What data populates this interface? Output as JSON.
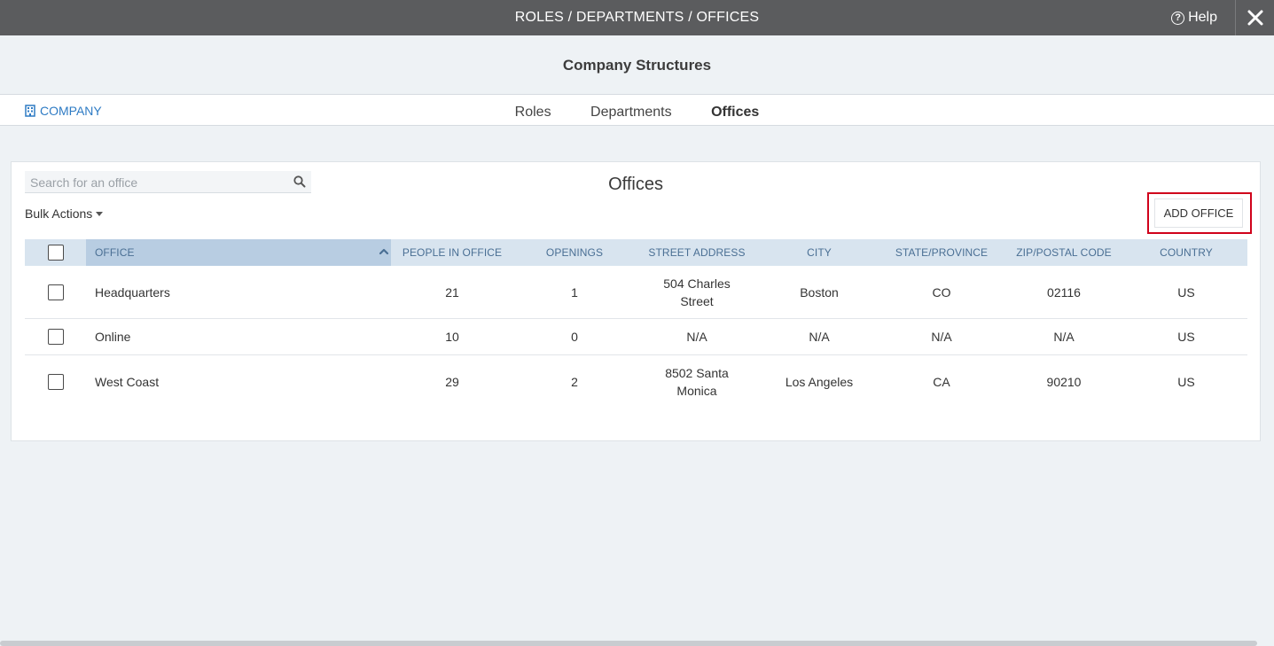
{
  "topbar": {
    "title": "ROLES / DEPARTMENTS / OFFICES",
    "help_label": "Help"
  },
  "header": {
    "title": "Company Structures"
  },
  "nav": {
    "company_label": "COMPANY",
    "tabs": [
      {
        "label": "Roles",
        "active": false
      },
      {
        "label": "Departments",
        "active": false
      },
      {
        "label": "Offices",
        "active": true
      }
    ]
  },
  "panel": {
    "title": "Offices",
    "search_placeholder": "Search for an office",
    "bulk_actions_label": "Bulk Actions",
    "add_button_label": "ADD OFFICE"
  },
  "table": {
    "columns": {
      "office": "OFFICE",
      "people": "PEOPLE IN OFFICE",
      "openings": "OPENINGS",
      "street": "STREET ADDRESS",
      "city": "CITY",
      "state": "STATE/PROVINCE",
      "zip": "ZIP/POSTAL CODE",
      "country": "COUNTRY"
    },
    "rows": [
      {
        "office": "Headquarters",
        "people": "21",
        "openings": "1",
        "street": "504 Charles Street",
        "city": "Boston",
        "state": "CO",
        "zip": "02116",
        "country": "US"
      },
      {
        "office": "Online",
        "people": "10",
        "openings": "0",
        "street": "N/A",
        "city": "N/A",
        "state": "N/A",
        "zip": "N/A",
        "country": "US"
      },
      {
        "office": "West Coast",
        "people": "29",
        "openings": "2",
        "street": "8502 Santa Monica",
        "city": "Los Angeles",
        "state": "CA",
        "zip": "90210",
        "country": "US"
      }
    ]
  },
  "colors": {
    "topbar_bg": "#5b5c5e",
    "link_blue": "#2e7bc4",
    "header_row_bg": "#d8e4ef",
    "sorted_column_bg": "#b8cde2",
    "highlight_red": "#d0021b"
  }
}
